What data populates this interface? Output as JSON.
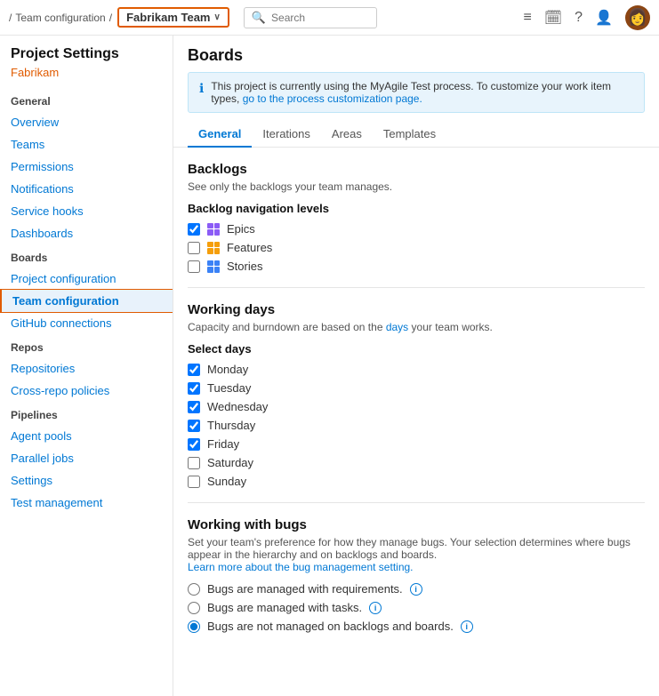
{
  "topnav": {
    "breadcrumb_sep": "/",
    "breadcrumb_item": "Team configuration",
    "team_name": "Fabrikam Team",
    "chevron": "∨",
    "search_placeholder": "Search"
  },
  "sidebar": {
    "title": "Project Settings",
    "project_name": "Fabrikam",
    "sections": [
      {
        "label": "General",
        "items": [
          {
            "id": "overview",
            "label": "Overview",
            "active": false
          },
          {
            "id": "teams",
            "label": "Teams",
            "active": false
          },
          {
            "id": "permissions",
            "label": "Permissions",
            "active": false
          },
          {
            "id": "notifications",
            "label": "Notifications",
            "active": false
          },
          {
            "id": "service-hooks",
            "label": "Service hooks",
            "active": false
          },
          {
            "id": "dashboards",
            "label": "Dashboards",
            "active": false
          }
        ]
      },
      {
        "label": "Boards",
        "items": [
          {
            "id": "project-configuration",
            "label": "Project configuration",
            "active": false
          },
          {
            "id": "team-configuration",
            "label": "Team configuration",
            "active": true
          },
          {
            "id": "github-connections",
            "label": "GitHub connections",
            "active": false
          }
        ]
      },
      {
        "label": "Repos",
        "items": [
          {
            "id": "repositories",
            "label": "Repositories",
            "active": false
          },
          {
            "id": "cross-repo-policies",
            "label": "Cross-repo policies",
            "active": false
          }
        ]
      },
      {
        "label": "Pipelines",
        "items": [
          {
            "id": "agent-pools",
            "label": "Agent pools",
            "active": false
          },
          {
            "id": "parallel-jobs",
            "label": "Parallel jobs",
            "active": false
          },
          {
            "id": "settings",
            "label": "Settings",
            "active": false
          },
          {
            "id": "test-management",
            "label": "Test management",
            "active": false
          }
        ]
      }
    ]
  },
  "main": {
    "title": "Boards",
    "info_banner": "This project is currently using the MyAgile Test process. To customize your work item types,",
    "info_link": "go to the process customization page.",
    "tabs": [
      {
        "id": "general",
        "label": "General",
        "active": true
      },
      {
        "id": "iterations",
        "label": "Iterations",
        "active": false
      },
      {
        "id": "areas",
        "label": "Areas",
        "active": false
      },
      {
        "id": "templates",
        "label": "Templates",
        "active": false
      }
    ],
    "backlogs": {
      "section_title": "Backlogs",
      "section_desc": "See only the backlogs your team manages.",
      "subsection_title": "Backlog navigation levels",
      "items": [
        {
          "id": "epics",
          "label": "Epics",
          "checked": true,
          "icon": "epics-icon"
        },
        {
          "id": "features",
          "label": "Features",
          "checked": false,
          "icon": "features-icon"
        },
        {
          "id": "stories",
          "label": "Stories",
          "checked": false,
          "icon": "stories-icon"
        }
      ]
    },
    "working_days": {
      "section_title": "Working days",
      "section_desc": "Capacity and burndown are based on the days your team works.",
      "link_text": "days",
      "subsection_title": "Select days",
      "days": [
        {
          "id": "monday",
          "label": "Monday",
          "checked": true
        },
        {
          "id": "tuesday",
          "label": "Tuesday",
          "checked": true
        },
        {
          "id": "wednesday",
          "label": "Wednesday",
          "checked": true
        },
        {
          "id": "thursday",
          "label": "Thursday",
          "checked": true
        },
        {
          "id": "friday",
          "label": "Friday",
          "checked": true
        },
        {
          "id": "saturday",
          "label": "Saturday",
          "checked": false
        },
        {
          "id": "sunday",
          "label": "Sunday",
          "checked": false
        }
      ]
    },
    "bugs": {
      "section_title": "Working with bugs",
      "section_desc": "Set your team's preference for how they manage bugs. Your selection determines where bugs appear in the hierarchy and on backlogs and boards.",
      "learn_more_link": "Learn more about the bug management setting.",
      "options": [
        {
          "id": "bugs-requirements",
          "label": "Bugs are managed with requirements.",
          "checked": false
        },
        {
          "id": "bugs-tasks",
          "label": "Bugs are managed with tasks.",
          "checked": false
        },
        {
          "id": "bugs-not-managed",
          "label": "Bugs are not managed on backlogs and boards.",
          "checked": true
        }
      ]
    }
  }
}
